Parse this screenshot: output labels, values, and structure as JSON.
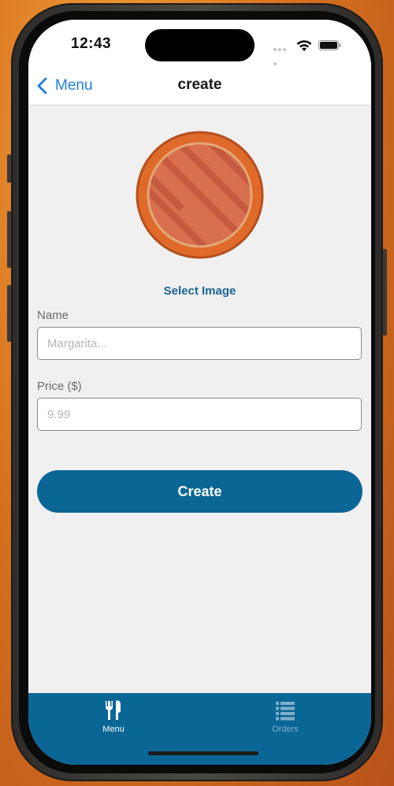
{
  "status_bar": {
    "time": "12:43",
    "icons": [
      "cellular-signal-icon",
      "wifi-icon",
      "battery-icon"
    ]
  },
  "navigation": {
    "back_label": "Menu",
    "back_icon": "chevron-left-icon",
    "title": "create"
  },
  "form": {
    "image_icon": "pizza-image",
    "select_image_label": "Select Image",
    "name": {
      "label": "Name",
      "placeholder": "Margarita...",
      "value": ""
    },
    "price": {
      "label": "Price ($)",
      "placeholder": "9.99",
      "value": ""
    },
    "submit_label": "Create"
  },
  "tab_bar": {
    "tabs": [
      {
        "label": "Menu",
        "icon": "fork-knife-icon",
        "active": true
      },
      {
        "label": "Orders",
        "icon": "list-icon",
        "active": false
      }
    ]
  },
  "colors": {
    "primary": "#0a6695",
    "link": "#1b6494",
    "ios_blue": "#1f7fd8",
    "background": "#f0f0f0",
    "tab_inactive": "#7fb0cb"
  }
}
